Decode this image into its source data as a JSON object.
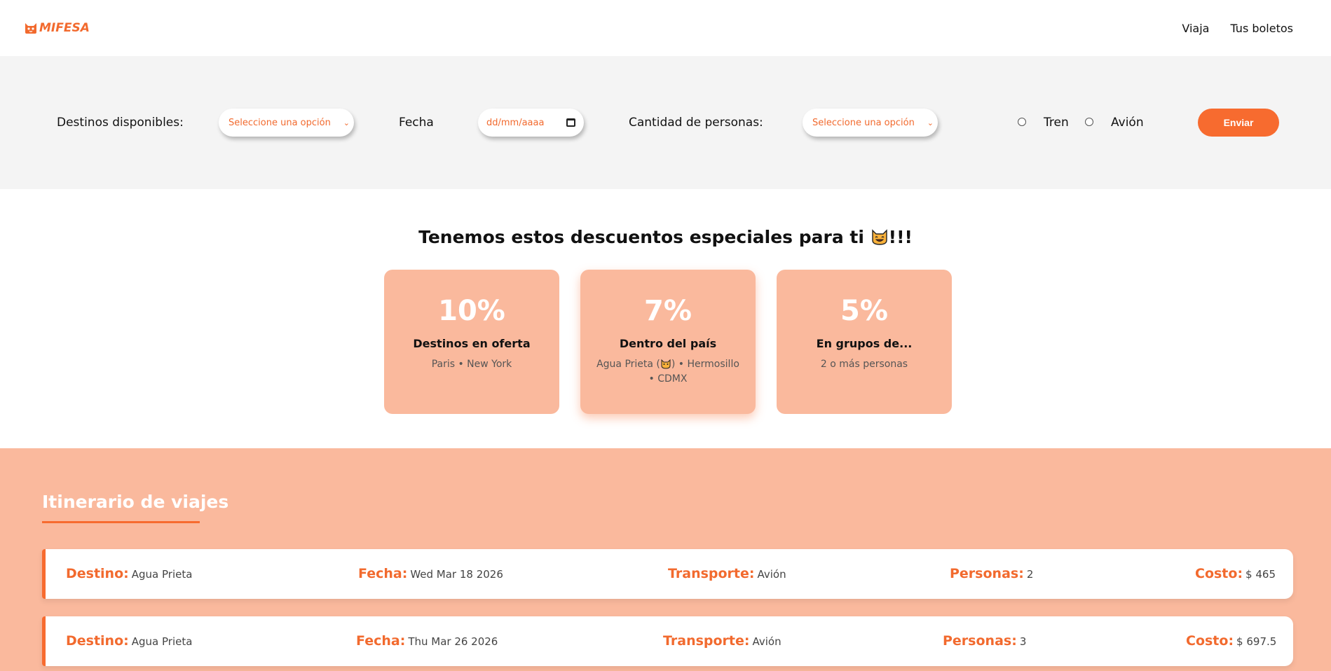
{
  "header": {
    "brand": "MIFESA",
    "nav": [
      "Viaja",
      "Tus boletos"
    ]
  },
  "search": {
    "destinations_label": "Destinos disponibles:",
    "destinations_value": "Seleccione una opción",
    "date_label": "Fecha",
    "date_placeholder": "dd/mm/aaaa",
    "people_label": "Cantidad de personas:",
    "people_value": "Seleccione una opción",
    "transport_options": [
      "Tren",
      "Avión"
    ],
    "submit_label": "Enviar"
  },
  "discounts": {
    "title_before": "Tenemos estos descuentos especiales para ti",
    "title_after": "!!!",
    "cards": [
      {
        "percent": "10%",
        "title": "Destinos en oferta",
        "subtitle": "Paris • New York"
      },
      {
        "percent": "7%",
        "title": "Dentro del país",
        "subtitle_before": "Agua Prieta (",
        "subtitle_after": ") • Hermosillo • CDMX"
      },
      {
        "percent": "5%",
        "title": "En grupos de...",
        "subtitle": "2 o más personas"
      }
    ]
  },
  "itinerary": {
    "title": "Itinerario de viajes",
    "keys": {
      "destino": "Destino:",
      "fecha": "Fecha:",
      "transporte": "Transporte:",
      "personas": "Personas:",
      "costo": "Costo:"
    },
    "rows": [
      {
        "destino": "Agua Prieta",
        "fecha": "Wed Mar 18 2026",
        "transporte": "Avión",
        "personas": "2",
        "costo": "$ 465"
      },
      {
        "destino": "Agua Prieta",
        "fecha": "Thu Mar 26 2026",
        "transporte": "Avión",
        "personas": "3",
        "costo": "$ 697.5"
      }
    ]
  },
  "colors": {
    "accent": "#f76b2f",
    "card": "#fab99d",
    "search_bg": "#f4f4f4"
  }
}
